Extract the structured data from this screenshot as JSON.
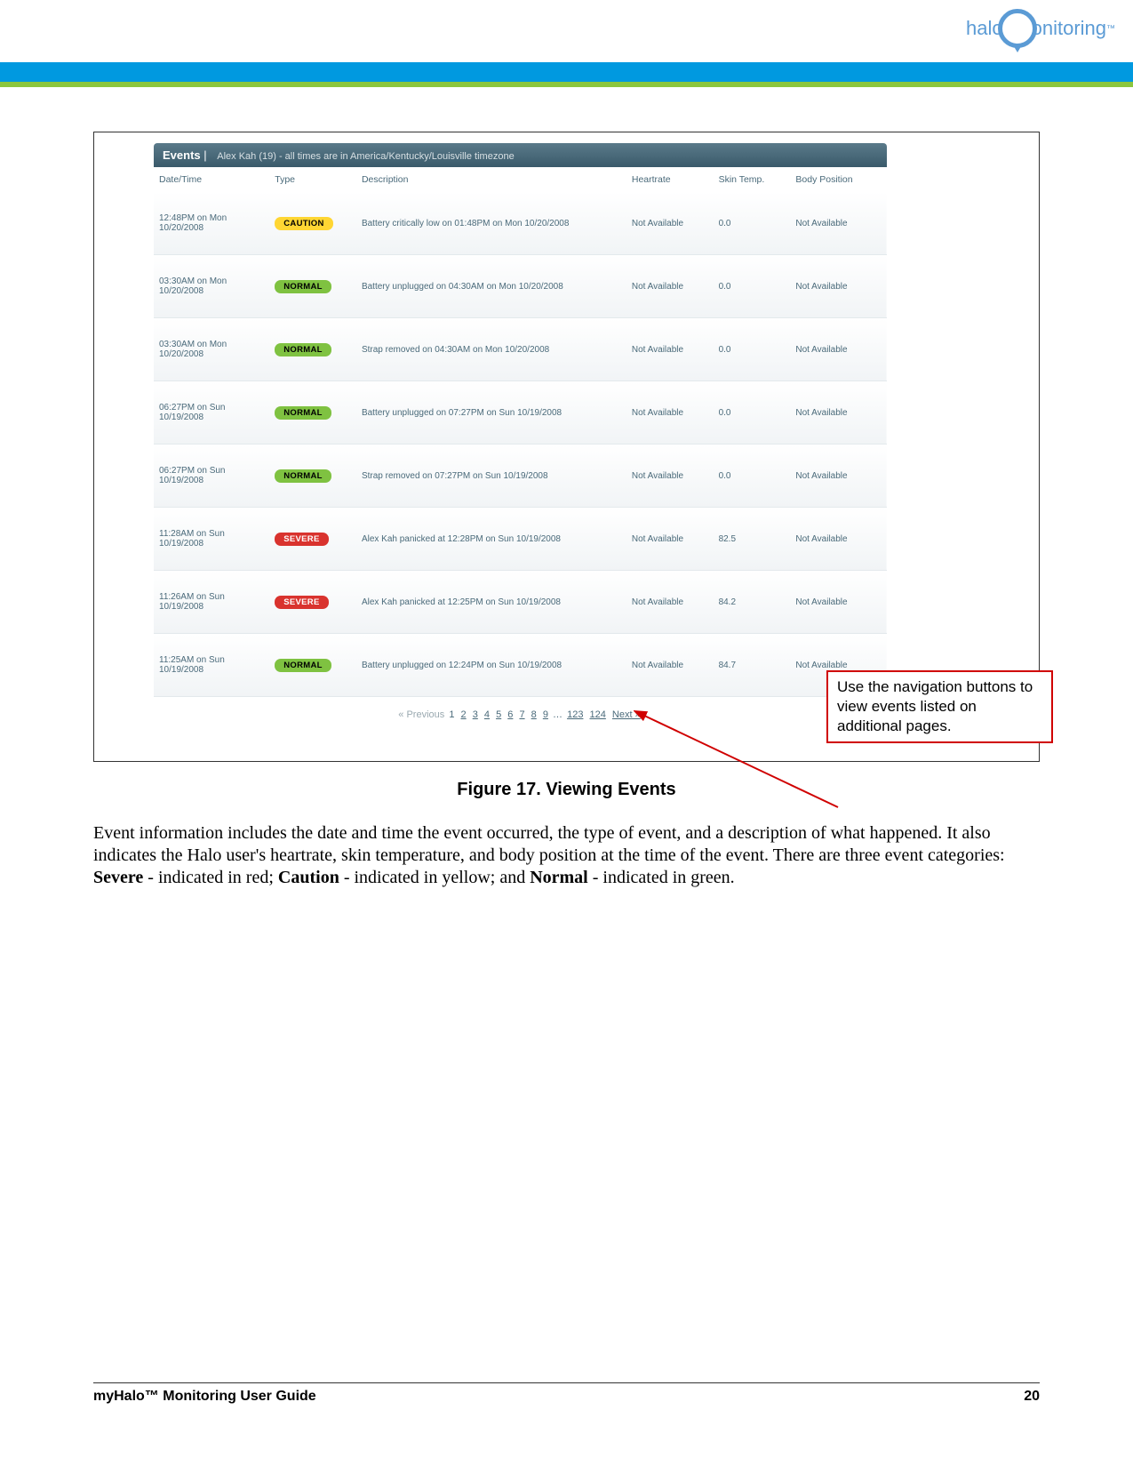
{
  "logo": {
    "left": "halo",
    "right": "onitoring"
  },
  "events_header": {
    "title": "Events",
    "subtitle": "Alex Kah (19) - all times are in America/Kentucky/Louisville timezone"
  },
  "columns": {
    "datetime": "Date/Time",
    "type": "Type",
    "description": "Description",
    "heartrate": "Heartrate",
    "skintemp": "Skin Temp.",
    "bodyposition": "Body Position"
  },
  "rows": [
    {
      "dt1": "12:48PM on Mon",
      "dt2": "10/20/2008",
      "type": "CAUTION",
      "typecls": "caution",
      "desc": "Battery critically low on 01:48PM on Mon 10/20/2008",
      "hr": "Not Available",
      "st": "0.0",
      "bp": "Not Available"
    },
    {
      "dt1": "03:30AM on Mon",
      "dt2": "10/20/2008",
      "type": "NORMAL",
      "typecls": "normal",
      "desc": "Battery unplugged on 04:30AM on Mon 10/20/2008",
      "hr": "Not Available",
      "st": "0.0",
      "bp": "Not Available"
    },
    {
      "dt1": "03:30AM on Mon",
      "dt2": "10/20/2008",
      "type": "NORMAL",
      "typecls": "normal",
      "desc": "Strap removed on 04:30AM on Mon 10/20/2008",
      "hr": "Not Available",
      "st": "0.0",
      "bp": "Not Available"
    },
    {
      "dt1": "06:27PM on Sun",
      "dt2": "10/19/2008",
      "type": "NORMAL",
      "typecls": "normal",
      "desc": "Battery unplugged on 07:27PM on Sun 10/19/2008",
      "hr": "Not Available",
      "st": "0.0",
      "bp": "Not Available"
    },
    {
      "dt1": "06:27PM on Sun",
      "dt2": "10/19/2008",
      "type": "NORMAL",
      "typecls": "normal",
      "desc": "Strap removed on 07:27PM on Sun 10/19/2008",
      "hr": "Not Available",
      "st": "0.0",
      "bp": "Not Available"
    },
    {
      "dt1": "11:28AM on Sun",
      "dt2": "10/19/2008",
      "type": "SEVERE",
      "typecls": "severe",
      "desc": "Alex Kah panicked at 12:28PM on Sun 10/19/2008",
      "hr": "Not Available",
      "st": "82.5",
      "bp": "Not Available"
    },
    {
      "dt1": "11:26AM on Sun",
      "dt2": "10/19/2008",
      "type": "SEVERE",
      "typecls": "severe",
      "desc": "Alex Kah panicked at 12:25PM on Sun 10/19/2008",
      "hr": "Not Available",
      "st": "84.2",
      "bp": "Not Available"
    },
    {
      "dt1": "11:25AM on Sun",
      "dt2": "10/19/2008",
      "type": "NORMAL",
      "typecls": "normal",
      "desc": "Battery unplugged on 12:24PM on Sun 10/19/2008",
      "hr": "Not Available",
      "st": "84.7",
      "bp": "Not Available"
    }
  ],
  "pagination": {
    "prev": "« Previous",
    "p1": "1",
    "links": [
      "2",
      "3",
      "4",
      "5",
      "6",
      "7",
      "8",
      "9"
    ],
    "ellipsis": "…",
    "pend1": "123",
    "pend2": "124",
    "next": "Next »"
  },
  "callout": "Use the navigation buttons to view events listed on additional pages.",
  "figure_caption": "Figure 17. Viewing Events",
  "body_paragraph": "Event information includes the date and time the event occurred, the type of event, and a description of what happened. It also indicates the Halo user's heartrate, skin temperature, and body position at the time of the event. There are three event categories: Severe - indicated in red; Caution - indicated in yellow; and Normal - indicated in green.",
  "body_html": "Event information includes the date and time the event occurred, the type of event, and a description of what happened. It also indicates the Halo user's heartrate, skin temperature, and body position at the time of the event. There are three event categories: <b>Severe</b> - indicated in red; <b>Caution</b> - indicated in yellow; and <b>Normal</b> - indicated in green.",
  "footer": {
    "left": "myHalo™ Monitoring User Guide",
    "right": "20"
  }
}
